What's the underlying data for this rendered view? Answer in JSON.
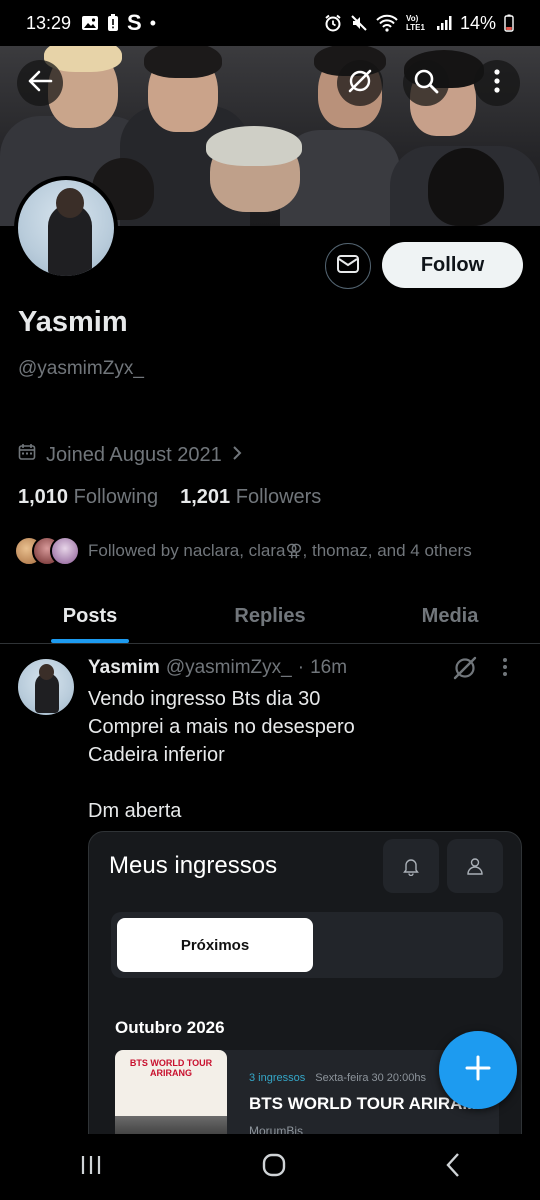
{
  "status_bar": {
    "time": "13:29",
    "s_label": "S",
    "dot": "•",
    "battery": "14%",
    "carrier": "Vo) LTE1",
    "colors": {
      "battery": "#e2574c"
    }
  },
  "header": {
    "back_icon": "arrow-left-icon",
    "grok_icon": "grok-icon",
    "search_icon": "search-icon",
    "more_icon": "more-vertical-icon"
  },
  "profile": {
    "name": "Yasmim",
    "handle": "@yasmimZyx_",
    "joined": "Joined August 2021",
    "following_count": "1,010",
    "following_label": "Following",
    "followers_count": "1,201",
    "followers_label": "Followers",
    "followed_by": "Followed by naclara, clara⚢, thomaz, and 4 others",
    "follow_label": "Follow"
  },
  "tabs": [
    {
      "label": "Posts",
      "active": true
    },
    {
      "label": "Replies",
      "active": false
    },
    {
      "label": "Media",
      "active": false
    }
  ],
  "post": {
    "name": "Yasmim",
    "handle": "@yasmimZyx_",
    "sep": "·",
    "time": "16m",
    "lines": [
      "Vendo ingresso Bts dia 30",
      "Comprei a mais no desespero",
      "Cadeira inferior",
      "",
      "Dm aberta"
    ],
    "media": {
      "title": "Meus ingressos",
      "segment_active": "Próximos",
      "month": "Outubro 2026",
      "ticket_count": "3 ingressos",
      "ticket_date": "Sexta-feira 30 20:00hs",
      "event_name": "BTS WORLD TOUR ARIRA...",
      "venue": "MorumBis",
      "poster_text": "BTS WORLD TOUR ARIRANG"
    }
  },
  "fab": {
    "icon": "plus-icon"
  },
  "colors": {
    "accent": "#1d9bf0",
    "muted": "#71767b",
    "text": "#e7e9ea",
    "background": "#000000"
  }
}
